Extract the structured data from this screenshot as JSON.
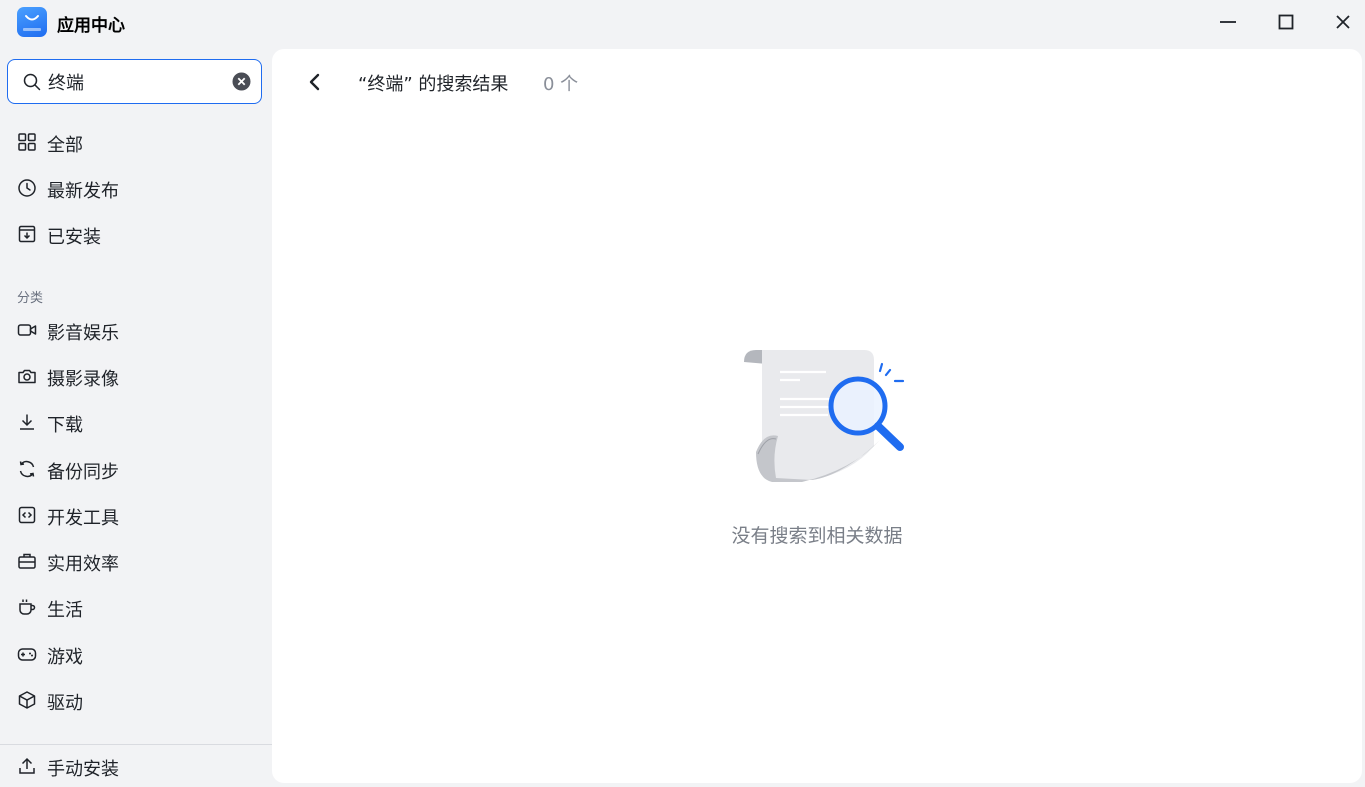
{
  "app": {
    "title": "应用中心",
    "logo_icon": "store-bag-icon",
    "accent_color": "#1f6cf0"
  },
  "window_controls": [
    "minimize-icon",
    "maximize-icon",
    "close-icon"
  ],
  "search": {
    "value": "终端",
    "icon": "search-icon",
    "clear_icon": "clear-circle-icon"
  },
  "nav": {
    "main_items": [
      {
        "label": "全部",
        "icon": "grid-icon"
      },
      {
        "label": "最新发布",
        "icon": "clock-icon"
      },
      {
        "label": "已安装",
        "icon": "installed-box-icon"
      }
    ],
    "section_label": "分类",
    "categories": [
      {
        "label": "影音娱乐",
        "icon": "video-camera-icon"
      },
      {
        "label": "摄影录像",
        "icon": "camera-icon"
      },
      {
        "label": "下载",
        "icon": "download-icon"
      },
      {
        "label": "备份同步",
        "icon": "sync-icon"
      },
      {
        "label": "开发工具",
        "icon": "code-icon"
      },
      {
        "label": "实用效率",
        "icon": "briefcase-icon"
      },
      {
        "label": "生活",
        "icon": "coffee-cup-icon"
      },
      {
        "label": "游戏",
        "icon": "gamepad-icon"
      },
      {
        "label": "驱动",
        "icon": "cube-icon"
      }
    ],
    "footer_item": {
      "label": "手动安装",
      "icon": "upload-icon"
    }
  },
  "main": {
    "back_icon": "chevron-left-icon",
    "result_title": "“终端” 的搜索结果",
    "result_count": "0 个",
    "empty_text": "没有搜索到相关数据",
    "empty_icon": "document-search-illustration"
  }
}
